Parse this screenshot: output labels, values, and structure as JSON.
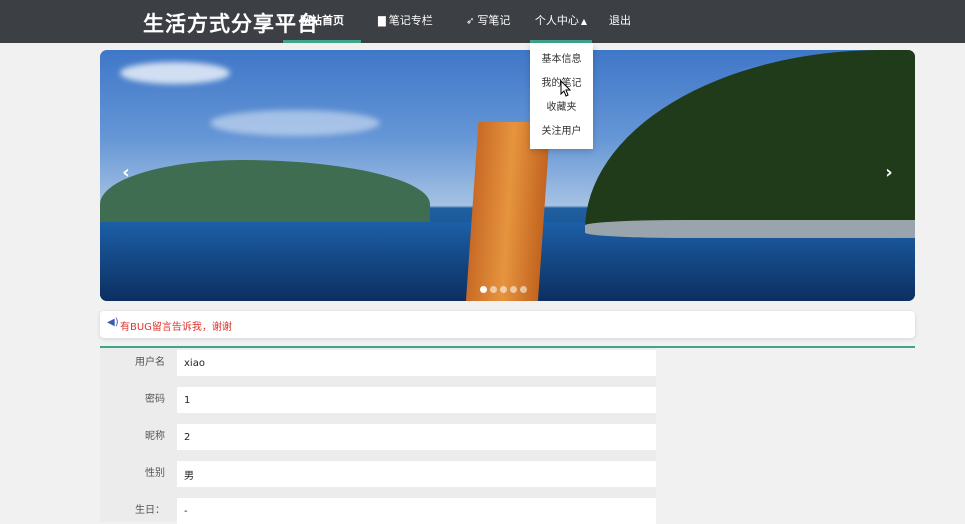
{
  "header": {
    "brand": "生活方式分享平台",
    "nav": {
      "home": "网站首页",
      "notes": "笔记专栏",
      "write": "写笔记",
      "center": "个人中心",
      "logout": "退出"
    }
  },
  "dropdown": {
    "items": [
      "基本信息",
      "我的笔记",
      "收藏夹",
      "关注用户"
    ]
  },
  "carousel": {
    "prev": "‹",
    "next": "›",
    "slide_count": 5,
    "active_slide": 1
  },
  "notice": {
    "icon": "volume-icon",
    "text": "有BUG留言告诉我，谢谢"
  },
  "form": {
    "fields": [
      {
        "label": "用户名",
        "value": "xiao"
      },
      {
        "label": "密码",
        "value": "1"
      },
      {
        "label": "昵称",
        "value": "2"
      },
      {
        "label": "性别",
        "value": "男"
      },
      {
        "label": "生日：",
        "value": "-"
      }
    ]
  },
  "colors": {
    "nav_bg": "#3c3f44",
    "accent": "#3fa58a",
    "notice_text": "#e0352e"
  }
}
